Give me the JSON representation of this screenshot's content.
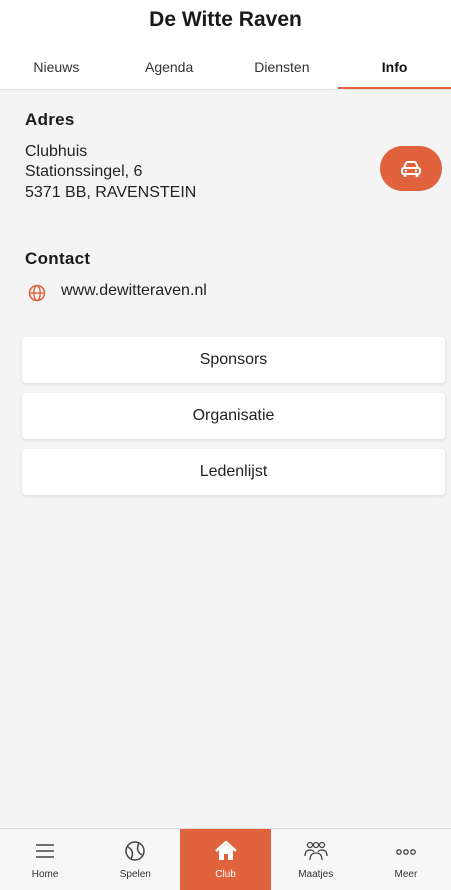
{
  "app": {
    "title": "De Witte Raven"
  },
  "tabs": [
    {
      "label": "Nieuws"
    },
    {
      "label": "Agenda"
    },
    {
      "label": "Diensten"
    },
    {
      "label": "Info"
    }
  ],
  "active_tab": "Info",
  "address": {
    "heading": "Adres",
    "lines": [
      "Clubhuis",
      "Stationssingel, 6",
      "5371 BB, RAVENSTEIN"
    ],
    "route_icon": "car-icon"
  },
  "contact": {
    "heading": "Contact",
    "website": "www.dewitteraven.nl",
    "website_icon": "globe-icon"
  },
  "buttons": [
    {
      "label": "Sponsors"
    },
    {
      "label": "Organisatie"
    },
    {
      "label": "Ledenlijst"
    }
  ],
  "bottom_nav": [
    {
      "label": "Home",
      "icon": "menu-icon"
    },
    {
      "label": "Spelen",
      "icon": "ball-icon"
    },
    {
      "label": "Club",
      "icon": "house-icon"
    },
    {
      "label": "Maatjes",
      "icon": "people-icon"
    },
    {
      "label": "Meer",
      "icon": "more-icon"
    }
  ],
  "active_nav": "Club",
  "colors": {
    "accent": "#e0633e",
    "background": "#f4f4f4"
  }
}
